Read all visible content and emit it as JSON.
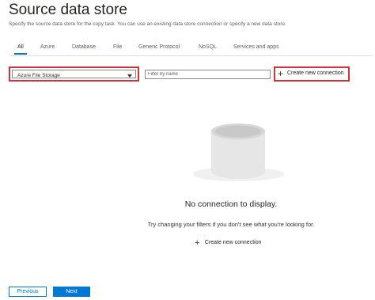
{
  "header": {
    "title": "Source data store",
    "subtitle": "Specify the source data store for the copy task. You can use an existing data store connection or specify a new data store."
  },
  "tabs": [
    {
      "label": "All",
      "active": true
    },
    {
      "label": "Azure",
      "active": false
    },
    {
      "label": "Database",
      "active": false
    },
    {
      "label": "File",
      "active": false
    },
    {
      "label": "Generic Protocol",
      "active": false
    },
    {
      "label": "NoSQL",
      "active": false
    },
    {
      "label": "Services and apps",
      "active": false
    }
  ],
  "toolbar": {
    "selected_type": "Azure File Storage",
    "filter_placeholder": "Filter by name",
    "create_label": "Create new connection"
  },
  "empty_state": {
    "title": "No connection to display.",
    "hint": "Try changing your filters if you don't see what you're looking for.",
    "create_label": "Create new connection",
    "icon": "database-cylinder-icon"
  },
  "footer": {
    "previous_label": "Previous",
    "next_label": "Next"
  },
  "colors": {
    "accent": "#0078d4",
    "highlight": "#d13438",
    "icon_gray": "#e8e8e8"
  }
}
